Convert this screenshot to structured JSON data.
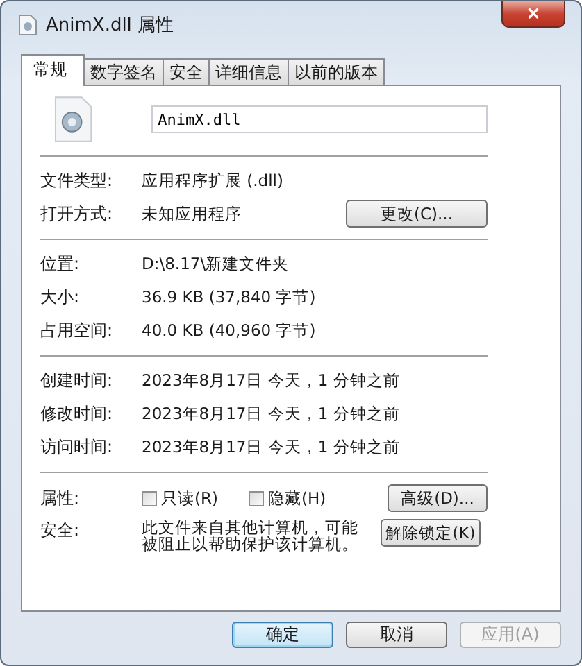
{
  "window": {
    "title": "AnimX.dll 属性",
    "close": "✕"
  },
  "tabs": [
    {
      "label": "常规",
      "selected": true
    },
    {
      "label": "数字签名",
      "selected": false
    },
    {
      "label": "安全",
      "selected": false
    },
    {
      "label": "详细信息",
      "selected": false
    },
    {
      "label": "以前的版本",
      "selected": false
    }
  ],
  "file_name": "AnimX.dll",
  "groups": [
    [
      {
        "label": "文件类型:",
        "value": "应用程序扩展 (.dll)"
      },
      {
        "label": "打开方式:",
        "value": "未知应用程序",
        "button": "更改(C)..."
      }
    ],
    [
      {
        "label": "位置:",
        "value": "D:\\8.17\\新建文件夹"
      },
      {
        "label": "大小:",
        "value": "36.9 KB (37,840 字节)"
      },
      {
        "label": "占用空间:",
        "value": "40.0 KB (40,960 字节)"
      }
    ],
    [
      {
        "label": "创建时间:",
        "value": "2023年8月17日  今天，1 分钟之前"
      },
      {
        "label": "修改时间:",
        "value": "2023年8月17日  今天，1 分钟之前"
      },
      {
        "label": "访问时间:",
        "value": "2023年8月17日  今天，1 分钟之前"
      }
    ]
  ],
  "attributes": {
    "label": "属性:",
    "checkboxes": [
      {
        "label": "只读(R)",
        "checked": false
      },
      {
        "label": "隐藏(H)",
        "checked": false
      }
    ],
    "button": "高级(D)..."
  },
  "security": {
    "label": "安全:",
    "text": "此文件来自其他计算机，可能被阻止以帮助保护该计算机。",
    "button": "解除锁定(K)"
  },
  "buttons": [
    {
      "label": "确定",
      "kind": "default",
      "disabled": false
    },
    {
      "label": "取消",
      "kind": "normal",
      "disabled": false
    },
    {
      "label": "应用(A)",
      "kind": "normal",
      "disabled": true
    }
  ]
}
